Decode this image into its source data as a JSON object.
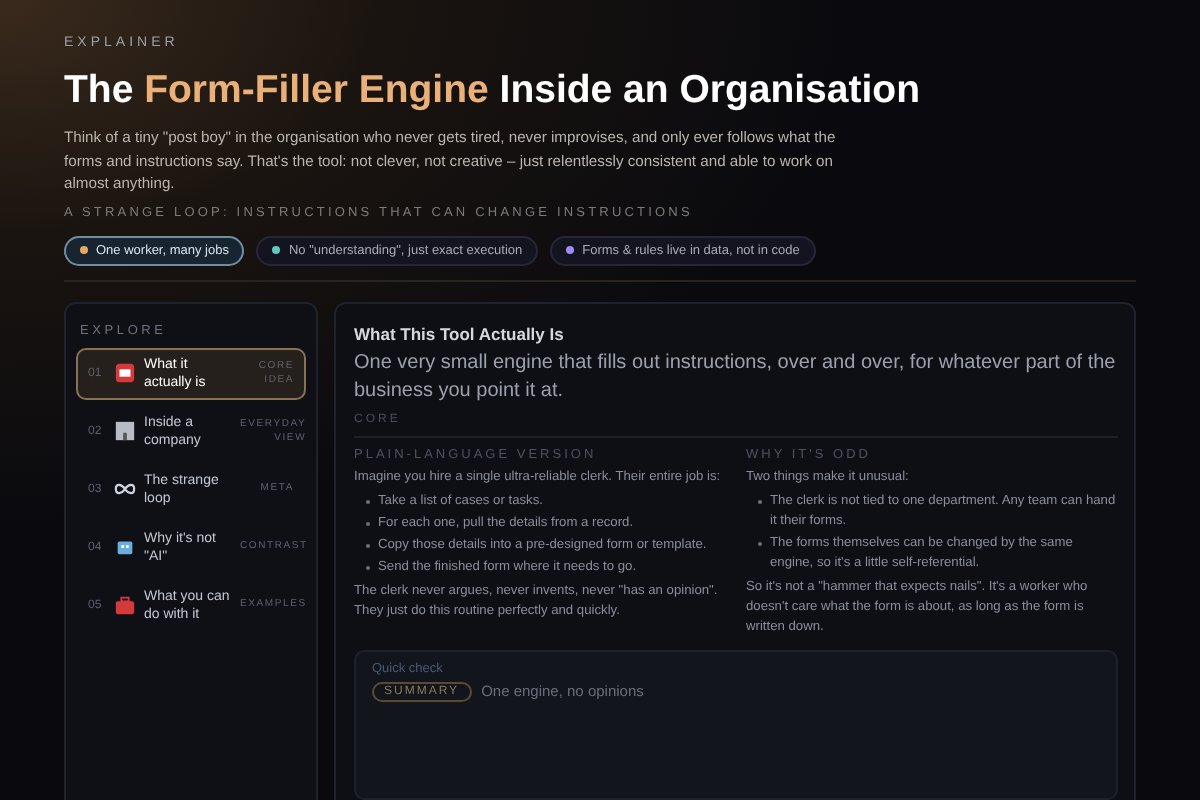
{
  "eyebrow": "EXPLAINER",
  "title": {
    "before": "The ",
    "highlight": "Form-Filler Engine",
    "after": " Inside an Organisation"
  },
  "intro": "Think of a tiny \"post boy\" in the organisation who never gets tired, never improvises, and only ever follows what the forms and instructions say. That's the tool: not clever, not creative – just relentlessly consistent and able to work on almost anything.",
  "subtitle": "A STRANGE LOOP: INSTRUCTIONS THAT CAN CHANGE INSTRUCTIONS",
  "chips": [
    {
      "label": "One worker, many jobs",
      "color": "#e8a860",
      "selected": true
    },
    {
      "label": "No \"understanding\", just exact execution",
      "color": "#5fc8c0",
      "selected": false
    },
    {
      "label": "Forms & rules live in data, not in code",
      "color": "#a08cf0",
      "selected": false
    }
  ],
  "sidebar": {
    "heading": "EXPLORE",
    "items": [
      {
        "number": "01",
        "title": "What it actually is",
        "tag": "CORE IDEA",
        "selected": true
      },
      {
        "number": "02",
        "title": "Inside a company",
        "tag": "EVERYDAY VIEW",
        "selected": false
      },
      {
        "number": "03",
        "title": "The strange loop",
        "tag": "META",
        "selected": false
      },
      {
        "number": "04",
        "title": "Why it's not \"AI\"",
        "tag": "CONTRAST",
        "selected": false
      },
      {
        "number": "05",
        "title": "What you can do with it",
        "tag": "EXAMPLES",
        "selected": false
      }
    ]
  },
  "panel": {
    "title": "What This Tool Actually Is",
    "lede": "One very small engine that fills out instructions, over and over, for whatever part of the business you point it at.",
    "tag": "CORE",
    "columns": [
      {
        "heading": "PLAIN-LANGUAGE VERSION",
        "intro": "Imagine you hire a single ultra-reliable clerk. Their entire job is:",
        "bullets": [
          "Take a list of cases or tasks.",
          "For each one, pull the details from a record.",
          "Copy those details into a pre-designed form or template.",
          "Send the finished form where it needs to go."
        ],
        "outro": "The clerk never argues, never invents, never \"has an opinion\". They just do this routine perfectly and quickly."
      },
      {
        "heading": "WHY IT'S ODD",
        "intro": "Two things make it unusual:",
        "bullets": [
          "The clerk is not tied to one department. Any team can hand it their forms.",
          "The forms themselves can be changed by the same engine, so it's a little self-referential."
        ],
        "outro": "So it's not a \"hammer that expects nails\". It's a worker who doesn't care what the form is about, as long as the form is written down."
      }
    ],
    "quick_check": {
      "label": "Quick check",
      "badge": "SUMMARY",
      "text": "One engine, no opinions"
    }
  }
}
